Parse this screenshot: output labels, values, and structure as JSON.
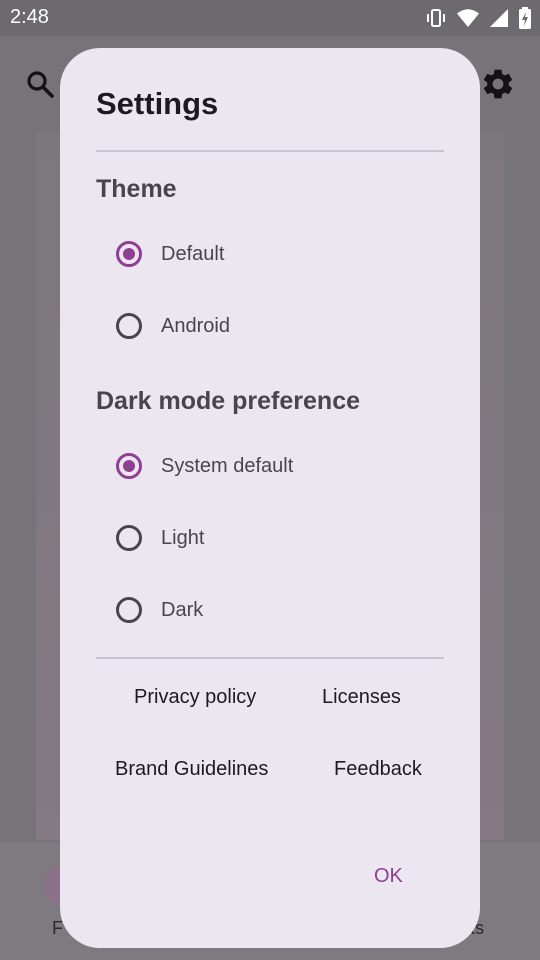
{
  "status_bar": {
    "time": "2:48",
    "icons": [
      "vibrate-icon",
      "wifi-icon",
      "cell-signal-icon",
      "battery-icon"
    ]
  },
  "background_app": {
    "bottom_nav_left_partial": "F",
    "bottom_nav_right_partial": "ts",
    "icons": [
      "search-icon",
      "gear-icon"
    ]
  },
  "dialog": {
    "title": "Settings",
    "theme": {
      "heading": "Theme",
      "options": [
        {
          "label": "Default",
          "selected": true
        },
        {
          "label": "Android",
          "selected": false
        }
      ]
    },
    "dark_mode": {
      "heading": "Dark mode preference",
      "options": [
        {
          "label": "System default",
          "selected": true
        },
        {
          "label": "Light",
          "selected": false
        },
        {
          "label": "Dark",
          "selected": false
        }
      ]
    },
    "links": {
      "privacy_policy": "Privacy policy",
      "licenses": "Licenses",
      "brand_guidelines": "Brand Guidelines",
      "feedback": "Feedback"
    },
    "ok_label": "OK"
  },
  "colors": {
    "accent": "#8e3f92",
    "dialog_surface": "#ece6f0",
    "scrim": "#777479"
  }
}
